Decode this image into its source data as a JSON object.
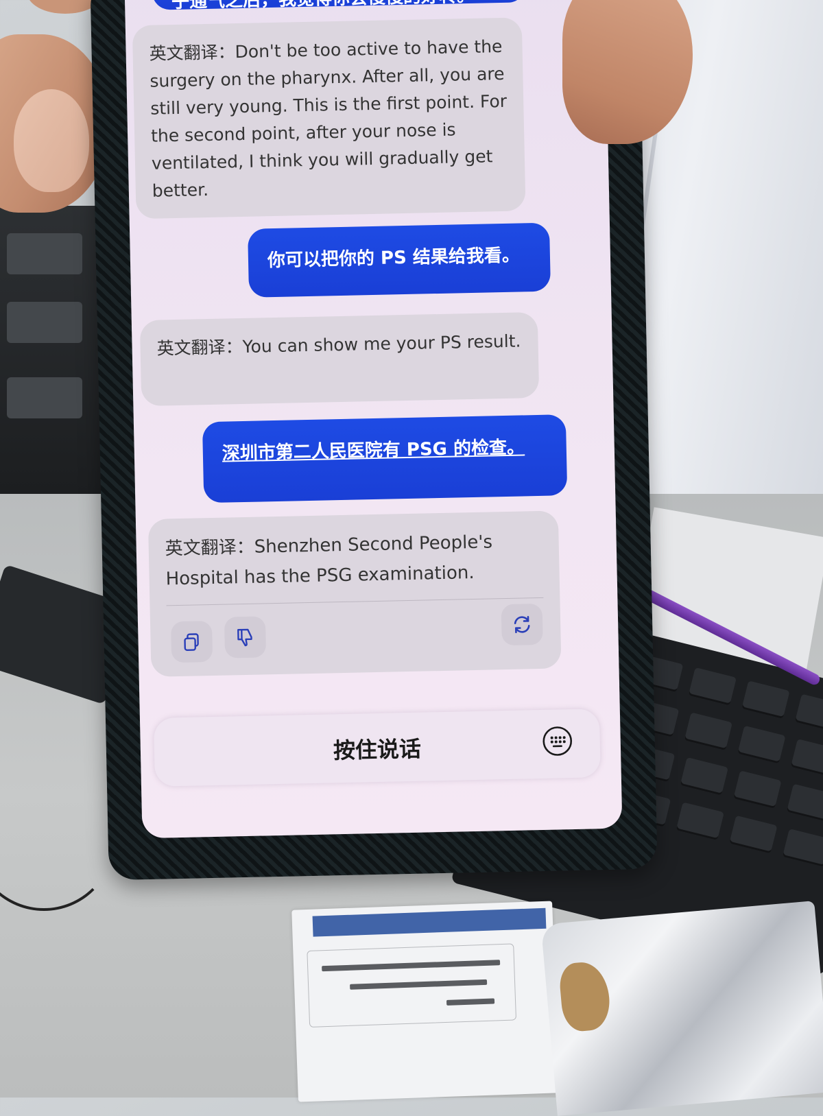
{
  "chat": {
    "messages": [
      {
        "role": "user",
        "text": "子通气之后，我觉得你会慢慢的好转。"
      },
      {
        "role": "assistant",
        "prefix": "英文翻译：",
        "text": "Don't be too active to have the surgery on the pharynx. After all, you are still very young. This is the first point. For the second point, after your nose is ventilated, I think you will gradually get better."
      },
      {
        "role": "user",
        "text": "你可以把你的 PS 结果给我看。"
      },
      {
        "role": "assistant",
        "prefix": "英文翻译：",
        "text": "You can show me your PS result."
      },
      {
        "role": "user",
        "text": "深圳市第二人民医院有 PSG 的检查。"
      },
      {
        "role": "assistant",
        "prefix": "英文翻译：",
        "text": "Shenzhen Second People's Hospital has the PSG examination."
      }
    ],
    "actions": {
      "copy_icon": "copy-icon",
      "dislike_icon": "thumbs-down-icon",
      "regenerate_icon": "refresh-icon"
    }
  },
  "input": {
    "hold_to_talk_label": "按住说话",
    "keyboard_icon": "keyboard-icon"
  },
  "colors": {
    "user_bubble": "#1e4be4",
    "assistant_bubble": "#dcd6df",
    "screen_bg": "#f2e6f3"
  }
}
